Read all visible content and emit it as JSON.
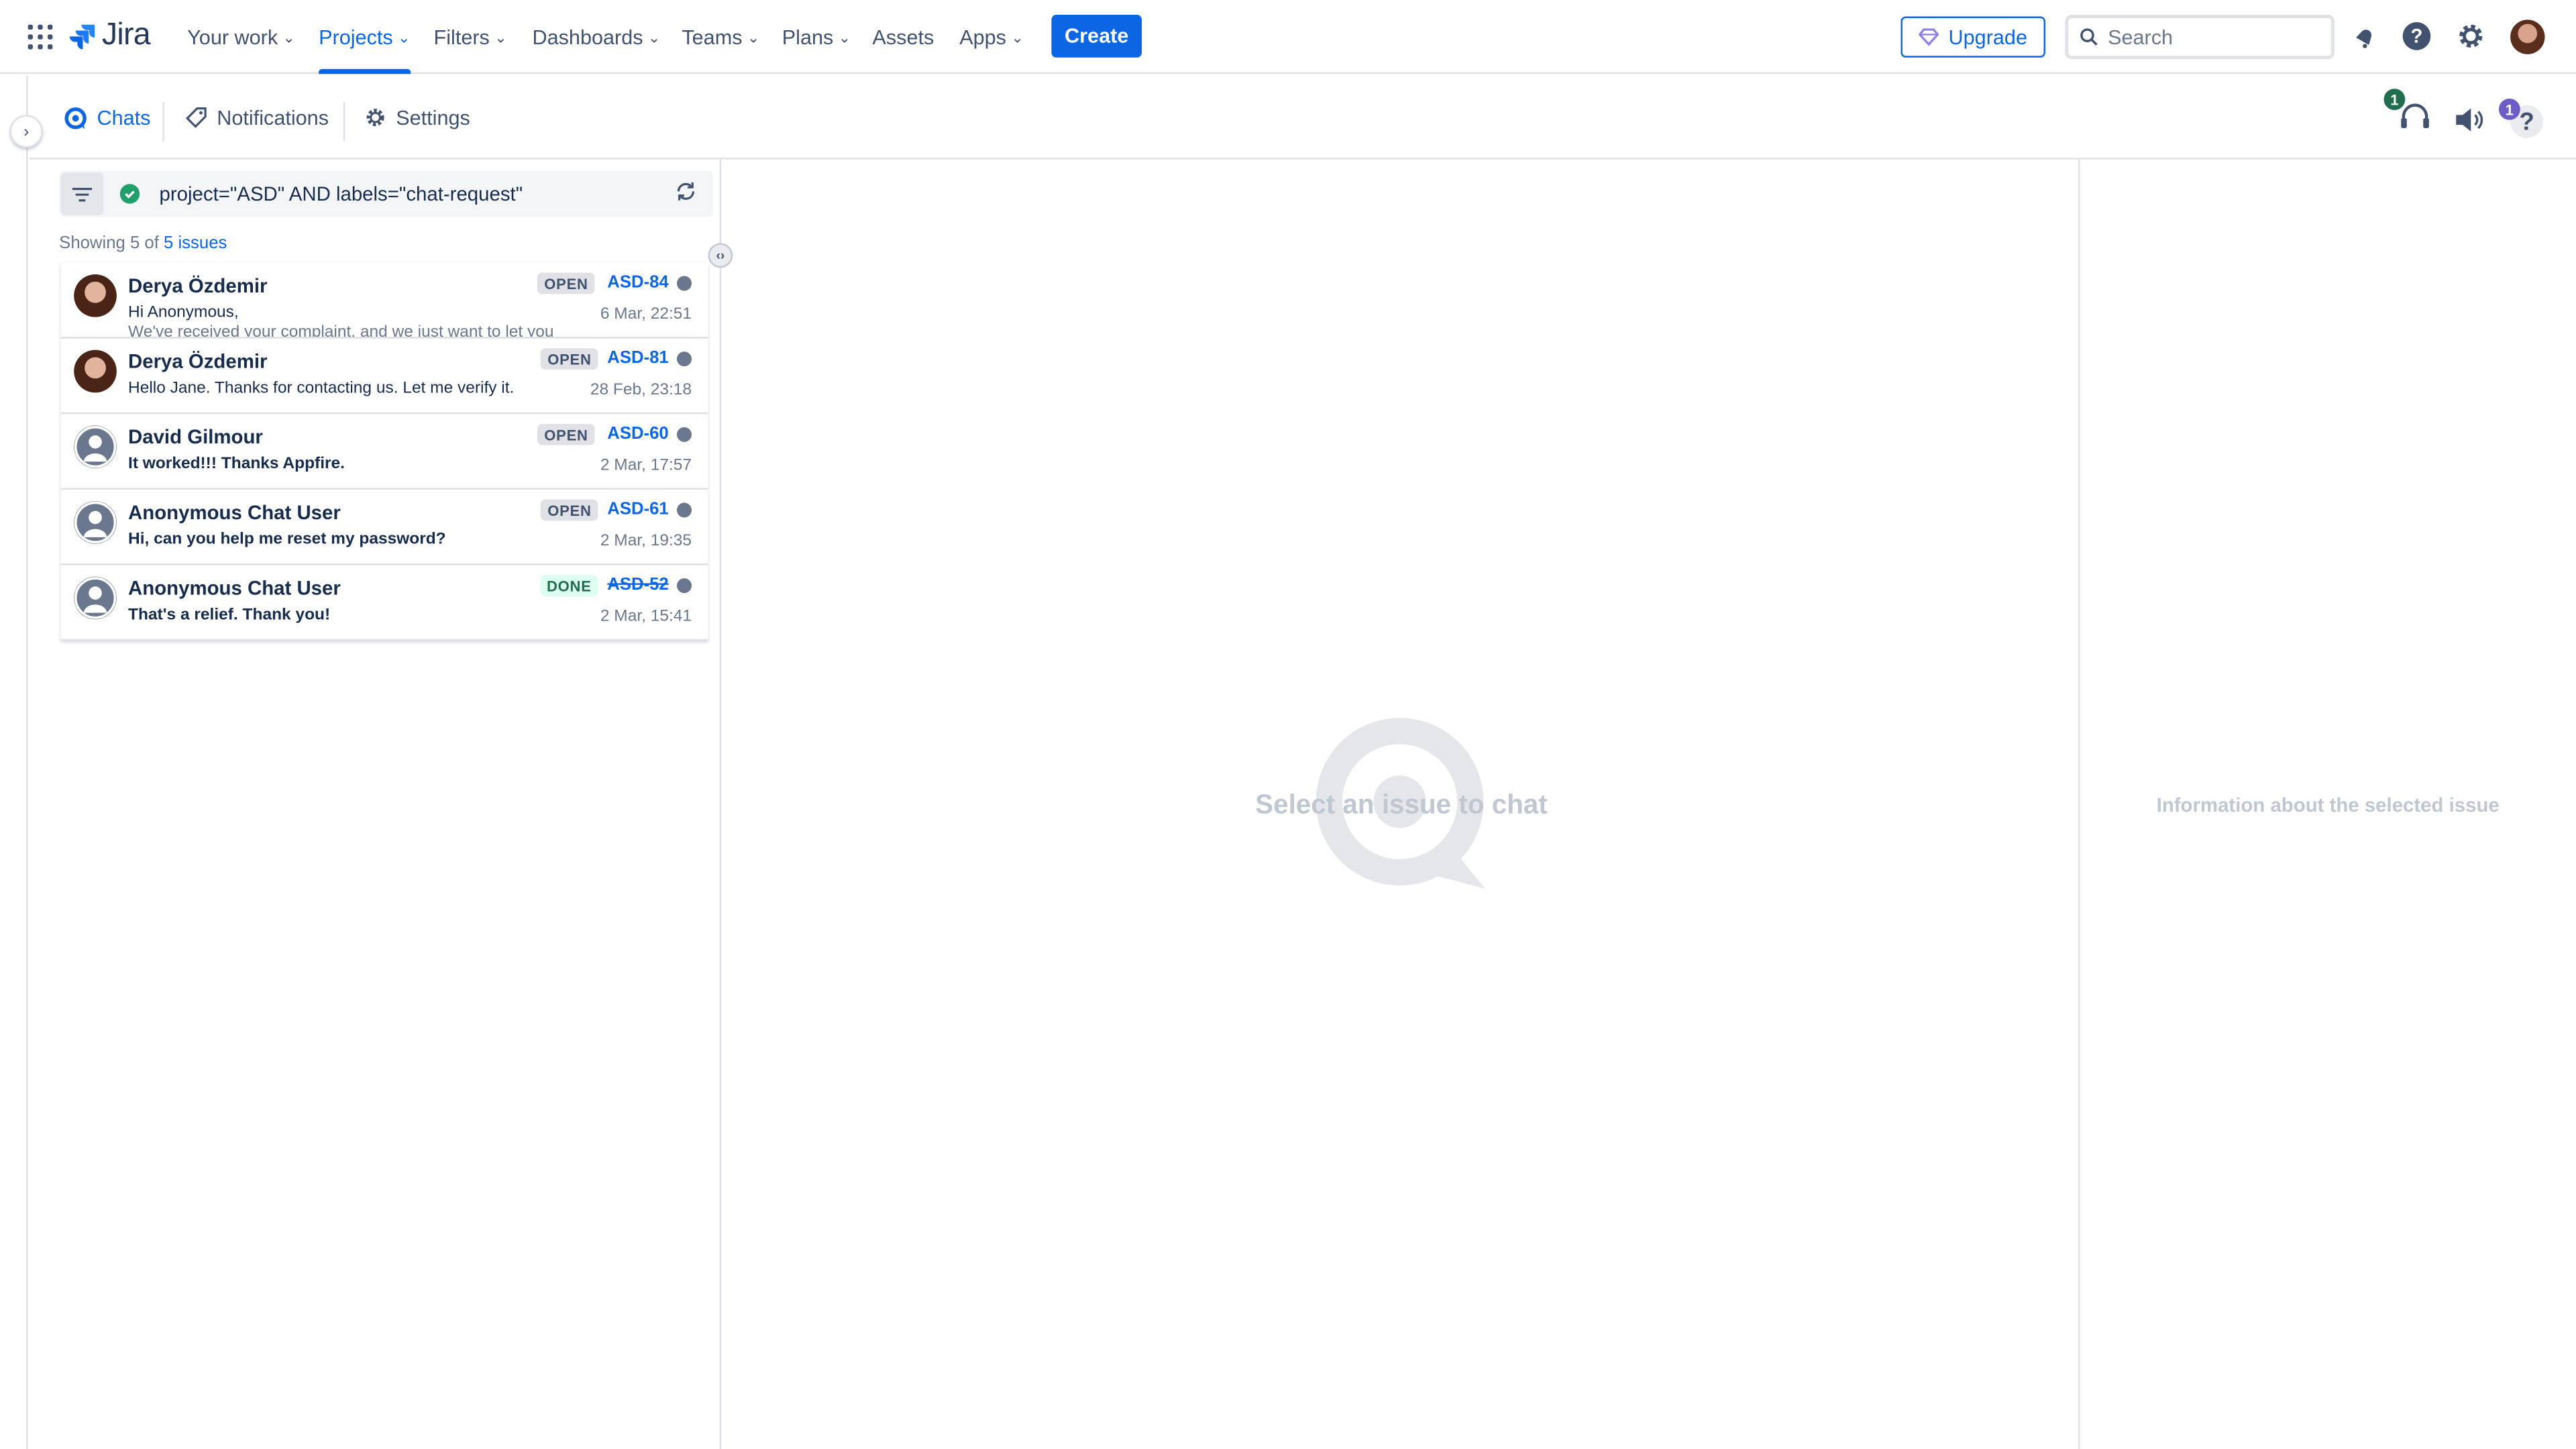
{
  "app": {
    "name": "Jira"
  },
  "topnav": {
    "items": [
      {
        "label": "Your work"
      },
      {
        "label": "Projects"
      },
      {
        "label": "Filters"
      },
      {
        "label": "Dashboards"
      },
      {
        "label": "Teams"
      },
      {
        "label": "Plans"
      },
      {
        "label": "Assets"
      },
      {
        "label": "Apps"
      }
    ],
    "create_label": "Create",
    "upgrade_label": "Upgrade",
    "search_placeholder": "Search"
  },
  "subnav": {
    "tabs": [
      {
        "label": "Chats"
      },
      {
        "label": "Notifications"
      },
      {
        "label": "Settings"
      }
    ],
    "agent_badge": "1",
    "help_badge": "1"
  },
  "filter": {
    "jql": "project=\"ASD\" AND labels=\"chat-request\"",
    "showing_prefix": "Showing 5 of",
    "showing_link": "5 issues"
  },
  "issues": [
    {
      "name": "Derya Özdemir",
      "message": "Hi Anonymous,",
      "message2": "We've received your complaint, and we just want to let you",
      "status": "OPEN",
      "key": "ASD-84",
      "time": "6 Mar, 22:51"
    },
    {
      "name": "Derya Özdemir",
      "message": "Hello Jane. Thanks for contacting us. Let me verify it.",
      "status": "OPEN",
      "key": "ASD-81",
      "time": "28 Feb, 23:18"
    },
    {
      "name": "David Gilmour",
      "message": "It worked!!! Thanks Appfire.",
      "status": "OPEN",
      "key": "ASD-60",
      "time": "2 Mar, 17:57"
    },
    {
      "name": "Anonymous Chat User",
      "message": "Hi, can you help me reset my password?",
      "status": "OPEN",
      "key": "ASD-61",
      "time": "2 Mar, 19:35"
    },
    {
      "name": "Anonymous Chat User",
      "message": "That's a relief. Thank you!",
      "status": "DONE",
      "key": "ASD-52",
      "time": "2 Mar, 15:41"
    }
  ],
  "chat": {
    "empty_text": "Select an issue to chat"
  },
  "info": {
    "empty_text": "Information about the selected issue"
  },
  "colors": {
    "brand": "#0c66e4",
    "done": "#216e4e",
    "ok": "#22a06b"
  }
}
